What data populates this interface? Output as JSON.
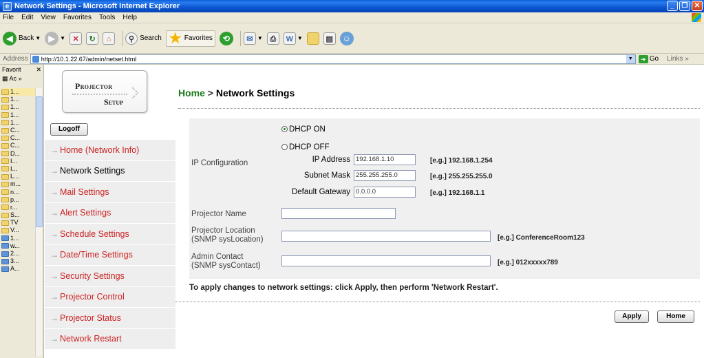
{
  "window": {
    "title": "Network Settings - Microsoft Internet Explorer"
  },
  "menu": [
    "File",
    "Edit",
    "View",
    "Favorites",
    "Tools",
    "Help"
  ],
  "toolbar": {
    "back": "Back",
    "search": "Search",
    "favorites": "Favorites"
  },
  "address": {
    "label": "Address",
    "url": "http://10.1.22.67/admin/netset.html",
    "go": "Go",
    "links": "Links"
  },
  "favorites_pane": {
    "title": "Favorit",
    "tool_label": "Ac",
    "items": [
      "1...",
      "1...",
      "1...",
      "1...",
      "1...",
      "C...",
      "C...",
      "C...",
      "D...",
      "I...",
      "I...",
      "L...",
      "m...",
      "n...",
      "p...",
      "r...",
      "S...",
      "TV",
      "V...",
      "1...",
      "w...",
      "2...",
      "3...",
      "A..."
    ]
  },
  "logo": {
    "line1": "Projector",
    "line2": "Setup"
  },
  "logoff_label": "Logoff",
  "nav": [
    "Home (Network Info)",
    "Network Settings",
    "Mail Settings",
    "Alert Settings",
    "Schedule Settings",
    "Date/Time Settings",
    "Security Settings",
    "Projector Control",
    "Projector Status",
    "Network Restart"
  ],
  "breadcrumb": {
    "home": "Home",
    "sep": ">",
    "current": "Network Settings"
  },
  "form": {
    "ip_config_label": "IP Configuration",
    "dhcp_on": "DHCP ON",
    "dhcp_off": "DHCP OFF",
    "ip_address_label": "IP Address",
    "ip_address_value": "192.168.1.10",
    "ip_address_eg": "[e.g.] 192.168.1.254",
    "subnet_label": "Subnet Mask",
    "subnet_value": "255.255.255.0",
    "subnet_eg": "[e.g.] 255.255.255.0",
    "gateway_label": "Default Gateway",
    "gateway_value": "0.0.0.0",
    "gateway_eg": "[e.g.] 192.168.1.1",
    "projector_name_label": "Projector Name",
    "projector_name_value": "",
    "location_label_1": "Projector Location",
    "location_label_2": "(SNMP sysLocation)",
    "location_value": "",
    "location_eg": "[e.g.] ConferenceRoom123",
    "contact_label_1": "Admin Contact",
    "contact_label_2": "(SNMP sysContact)",
    "contact_value": "",
    "contact_eg": "[e.g.] 012xxxxx789"
  },
  "note": "To apply changes to network settings: click Apply, then perform 'Network Restart'.",
  "buttons": {
    "apply": "Apply",
    "home": "Home"
  }
}
